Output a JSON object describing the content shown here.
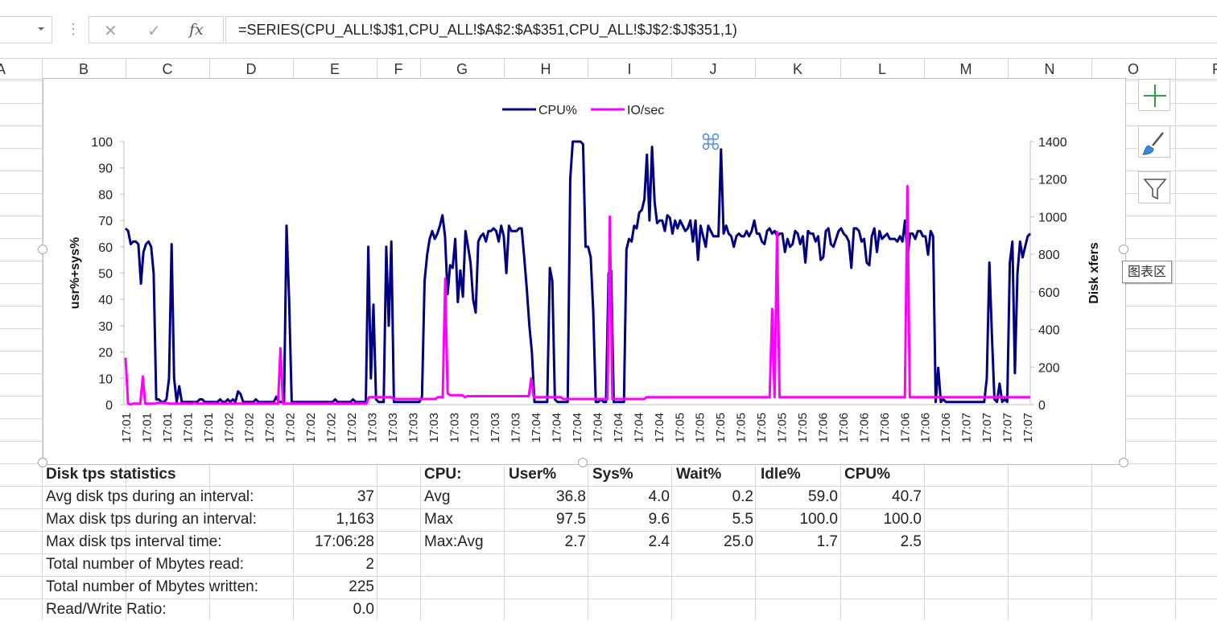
{
  "formula_bar": {
    "formula": "=SERIES(CPU_ALL!$J$1,CPU_ALL!$A$2:$A$351,CPU_ALL!$J$2:$J$351,1)",
    "fx_label": "fx"
  },
  "columns": [
    "A",
    "B",
    "C",
    "D",
    "E",
    "F",
    "G",
    "H",
    "I",
    "J",
    "K",
    "L",
    "M",
    "N",
    "O",
    "P"
  ],
  "chart_data": {
    "type": "line",
    "legend": {
      "position": "top",
      "entries": [
        "CPU%",
        "IO/sec"
      ]
    },
    "ylabel": "usr%+sys%",
    "y2label": "Disk xfers",
    "ylim": [
      0,
      100
    ],
    "y2lim": [
      0,
      1400
    ],
    "yticks": [
      "0",
      "10",
      "20",
      "30",
      "40",
      "50",
      "60",
      "70",
      "80",
      "90",
      "100"
    ],
    "y2ticks": [
      "0",
      "200",
      "400",
      "600",
      "800",
      "1000",
      "1200",
      "1400"
    ],
    "xticks": [
      "17:01",
      "17:01",
      "17:01",
      "17:01",
      "17:01",
      "17:02",
      "17:02",
      "17:02",
      "17:02",
      "17:02",
      "17:02",
      "17:02",
      "17:03",
      "17:03",
      "17:03",
      "17:03",
      "17:03",
      "17:03",
      "17:03",
      "17:03",
      "17:04",
      "17:04",
      "17:04",
      "17:04",
      "17:04",
      "17:04",
      "17:04",
      "17:05",
      "17:05",
      "17:05",
      "17:05",
      "17:05",
      "17:05",
      "17:05",
      "17:06",
      "17:06",
      "17:06",
      "17:06",
      "17:06",
      "17:06",
      "17:06",
      "17:07",
      "17:07",
      "17:07",
      "17:07"
    ],
    "series": [
      {
        "name": "CPU%",
        "color": "#000080",
        "axis": "left",
        "values": [
          67,
          66,
          61,
          62,
          62,
          61,
          46,
          58,
          61,
          62,
          60,
          50,
          2,
          2,
          1,
          1,
          2,
          10,
          61,
          10,
          1,
          7,
          1,
          1,
          1,
          1,
          1,
          1,
          1,
          2,
          2,
          1,
          1,
          1,
          1,
          1,
          1,
          2,
          1,
          1,
          2,
          1,
          2,
          1,
          5,
          4,
          1,
          1,
          1,
          1,
          1,
          2,
          1,
          1,
          1,
          1,
          1,
          1,
          1,
          3,
          1,
          1,
          1,
          68,
          40,
          1,
          1,
          1,
          1,
          1,
          1,
          1,
          1,
          1,
          1,
          1,
          1,
          1,
          1,
          1,
          1,
          1,
          2,
          1,
          1,
          1,
          1,
          1,
          1,
          2,
          1,
          1,
          1,
          1,
          1,
          60,
          10,
          38,
          2,
          1,
          1,
          1,
          60,
          30,
          62,
          1,
          1,
          1,
          1,
          1,
          1,
          1,
          1,
          1,
          1,
          1,
          3,
          47,
          57,
          63,
          66,
          63,
          65,
          68,
          72,
          64,
          42,
          53,
          52,
          63,
          39,
          51,
          41,
          66,
          60,
          54,
          40,
          35,
          62,
          64,
          65,
          62,
          66,
          66,
          67,
          66,
          62,
          68,
          64,
          50,
          68,
          66,
          66,
          66,
          67,
          67,
          56,
          44,
          30,
          20,
          1,
          1,
          1,
          1,
          1,
          1,
          52,
          47,
          2,
          1,
          1,
          1,
          1,
          1,
          86,
          100,
          100,
          100,
          100,
          99,
          60,
          60,
          56,
          35,
          1,
          1,
          2,
          1,
          1,
          50,
          51,
          1,
          1,
          1,
          1,
          1,
          59,
          63,
          62,
          68,
          67,
          73,
          74,
          78,
          95,
          70,
          98,
          77,
          69,
          70,
          70,
          66,
          72,
          71,
          65,
          70,
          67,
          70,
          68,
          66,
          67,
          70,
          62,
          70,
          55,
          68,
          64,
          60,
          68,
          66,
          64,
          64,
          64,
          97,
          65,
          68,
          65,
          64,
          60,
          64,
          65,
          64,
          64,
          66,
          64,
          66,
          70,
          65,
          65,
          62,
          61,
          66,
          67,
          65,
          66,
          64,
          65,
          65,
          58,
          63,
          60,
          61,
          66,
          65,
          61,
          64,
          54,
          66,
          65,
          65,
          62,
          64,
          55,
          56,
          66,
          67,
          61,
          60,
          63,
          66,
          67,
          65,
          64,
          62,
          52,
          67,
          67,
          66,
          62,
          63,
          54,
          53,
          64,
          67,
          58,
          66,
          63,
          64,
          65,
          63,
          63,
          63,
          62,
          64,
          62,
          70,
          56,
          65,
          65,
          63,
          66,
          66,
          64,
          64,
          57,
          66,
          64,
          1,
          14,
          1,
          2,
          1,
          1,
          1,
          1,
          1,
          1,
          1,
          1,
          1,
          1,
          1,
          1,
          1,
          1,
          1,
          1,
          10,
          54,
          26,
          2,
          1,
          8,
          1,
          2,
          1,
          54,
          62,
          12,
          50,
          62,
          56,
          60,
          64,
          65
        ],
        "values_note": "approximate"
      },
      {
        "name": "IO/sec",
        "color": "#FF00FF",
        "axis": "right",
        "values": [
          250,
          5,
          0,
          5,
          5,
          5,
          5,
          150,
          5,
          5,
          5,
          5,
          5,
          10,
          10,
          10,
          8,
          8,
          5,
          5,
          5,
          5,
          5,
          5,
          5,
          5,
          5,
          5,
          10,
          5,
          5,
          5,
          5,
          5,
          5,
          5,
          5,
          5,
          5,
          5,
          5,
          5,
          5,
          5,
          5,
          5,
          5,
          5,
          5,
          5,
          5,
          5,
          5,
          5,
          5,
          5,
          5,
          5,
          5,
          5,
          5,
          5,
          5,
          300,
          5,
          5,
          5,
          5,
          5,
          5,
          5,
          5,
          5,
          5,
          5,
          5,
          5,
          5,
          5,
          5,
          5,
          5,
          5,
          5,
          5,
          5,
          5,
          5,
          5,
          5,
          5,
          5,
          5,
          5,
          5,
          5,
          5,
          5,
          5,
          40,
          40,
          40,
          40,
          40,
          40,
          40,
          40,
          40,
          40,
          30,
          30,
          30,
          30,
          30,
          30,
          30,
          30,
          30,
          30,
          30,
          30,
          30,
          30,
          30,
          30,
          30,
          30,
          40,
          40,
          40,
          670,
          60,
          50,
          50,
          50,
          50,
          50,
          50,
          40,
          45,
          45,
          45,
          45,
          45,
          45,
          45,
          45,
          45,
          45,
          45,
          45,
          45,
          45,
          45,
          45,
          45,
          45,
          45,
          45,
          45,
          45,
          45,
          45,
          45,
          45,
          140,
          40,
          40,
          40,
          40,
          40,
          40,
          40,
          40,
          40,
          40,
          40,
          40,
          30,
          30,
          30,
          30,
          30,
          30,
          30,
          30,
          30,
          30,
          30,
          30,
          30,
          30,
          30,
          30,
          30,
          30,
          30,
          1000,
          30,
          30,
          30,
          30,
          30,
          30,
          30,
          30,
          30,
          30,
          30,
          30,
          30,
          30,
          40,
          40,
          40,
          40,
          40,
          40,
          40,
          40,
          40,
          40,
          40,
          40,
          40,
          40,
          40,
          40,
          40,
          40,
          40,
          40,
          40,
          40,
          40,
          40,
          40,
          40,
          40,
          40,
          40,
          40,
          40,
          40,
          40,
          40,
          40,
          40,
          40,
          40,
          40,
          40,
          40,
          40,
          40,
          40,
          40,
          40,
          40,
          40,
          40,
          40,
          40,
          510,
          40,
          920,
          40,
          40,
          40,
          40,
          40,
          40,
          40,
          40,
          40,
          40,
          40,
          40,
          40,
          40,
          40,
          40,
          40,
          40,
          40,
          40,
          40,
          40,
          40,
          40,
          40,
          40,
          40,
          40,
          40,
          40,
          40,
          40,
          40,
          40,
          40,
          40,
          40,
          40,
          40,
          40,
          40,
          40,
          40,
          40,
          40,
          40,
          40,
          40,
          40,
          40,
          40,
          40,
          1163,
          40,
          40,
          40,
          40,
          40,
          40,
          40,
          40,
          40,
          40,
          40,
          40,
          40,
          40,
          40,
          40,
          40,
          40,
          40,
          40,
          40,
          40,
          40,
          40,
          40,
          40,
          40,
          40,
          40,
          40,
          40,
          40,
          40,
          40,
          40,
          40,
          40,
          40,
          40,
          40,
          40,
          40,
          40,
          40,
          40,
          40,
          40,
          40,
          40,
          40
        ],
        "values_note": "approximate"
      }
    ]
  },
  "tooltip": "图表区",
  "disk_stats": {
    "title": "Disk tps statistics",
    "rows": [
      {
        "label": "Avg disk tps during an interval:",
        "value": "37"
      },
      {
        "label": "Max disk tps during an interval:",
        "value": "1,163"
      },
      {
        "label": "Max disk tps interval time:",
        "value": "17:06:28"
      },
      {
        "label": "Total number of Mbytes read:",
        "value": "2"
      },
      {
        "label": "Total number of Mbytes written:",
        "value": "225"
      },
      {
        "label": "Read/Write Ratio:",
        "value": "0.0"
      }
    ]
  },
  "cpu_stats": {
    "headers": [
      "CPU:",
      "User%",
      "Sys%",
      "Wait%",
      "Idle%",
      "CPU%"
    ],
    "rows": [
      [
        "Avg",
        "36.8",
        "4.0",
        "0.2",
        "59.0",
        "40.7"
      ],
      [
        "Max",
        "97.5",
        "9.6",
        "5.5",
        "100.0",
        "100.0"
      ],
      [
        "Max:Avg",
        "2.7",
        "2.4",
        "25.0",
        "1.7",
        "2.5"
      ]
    ]
  }
}
